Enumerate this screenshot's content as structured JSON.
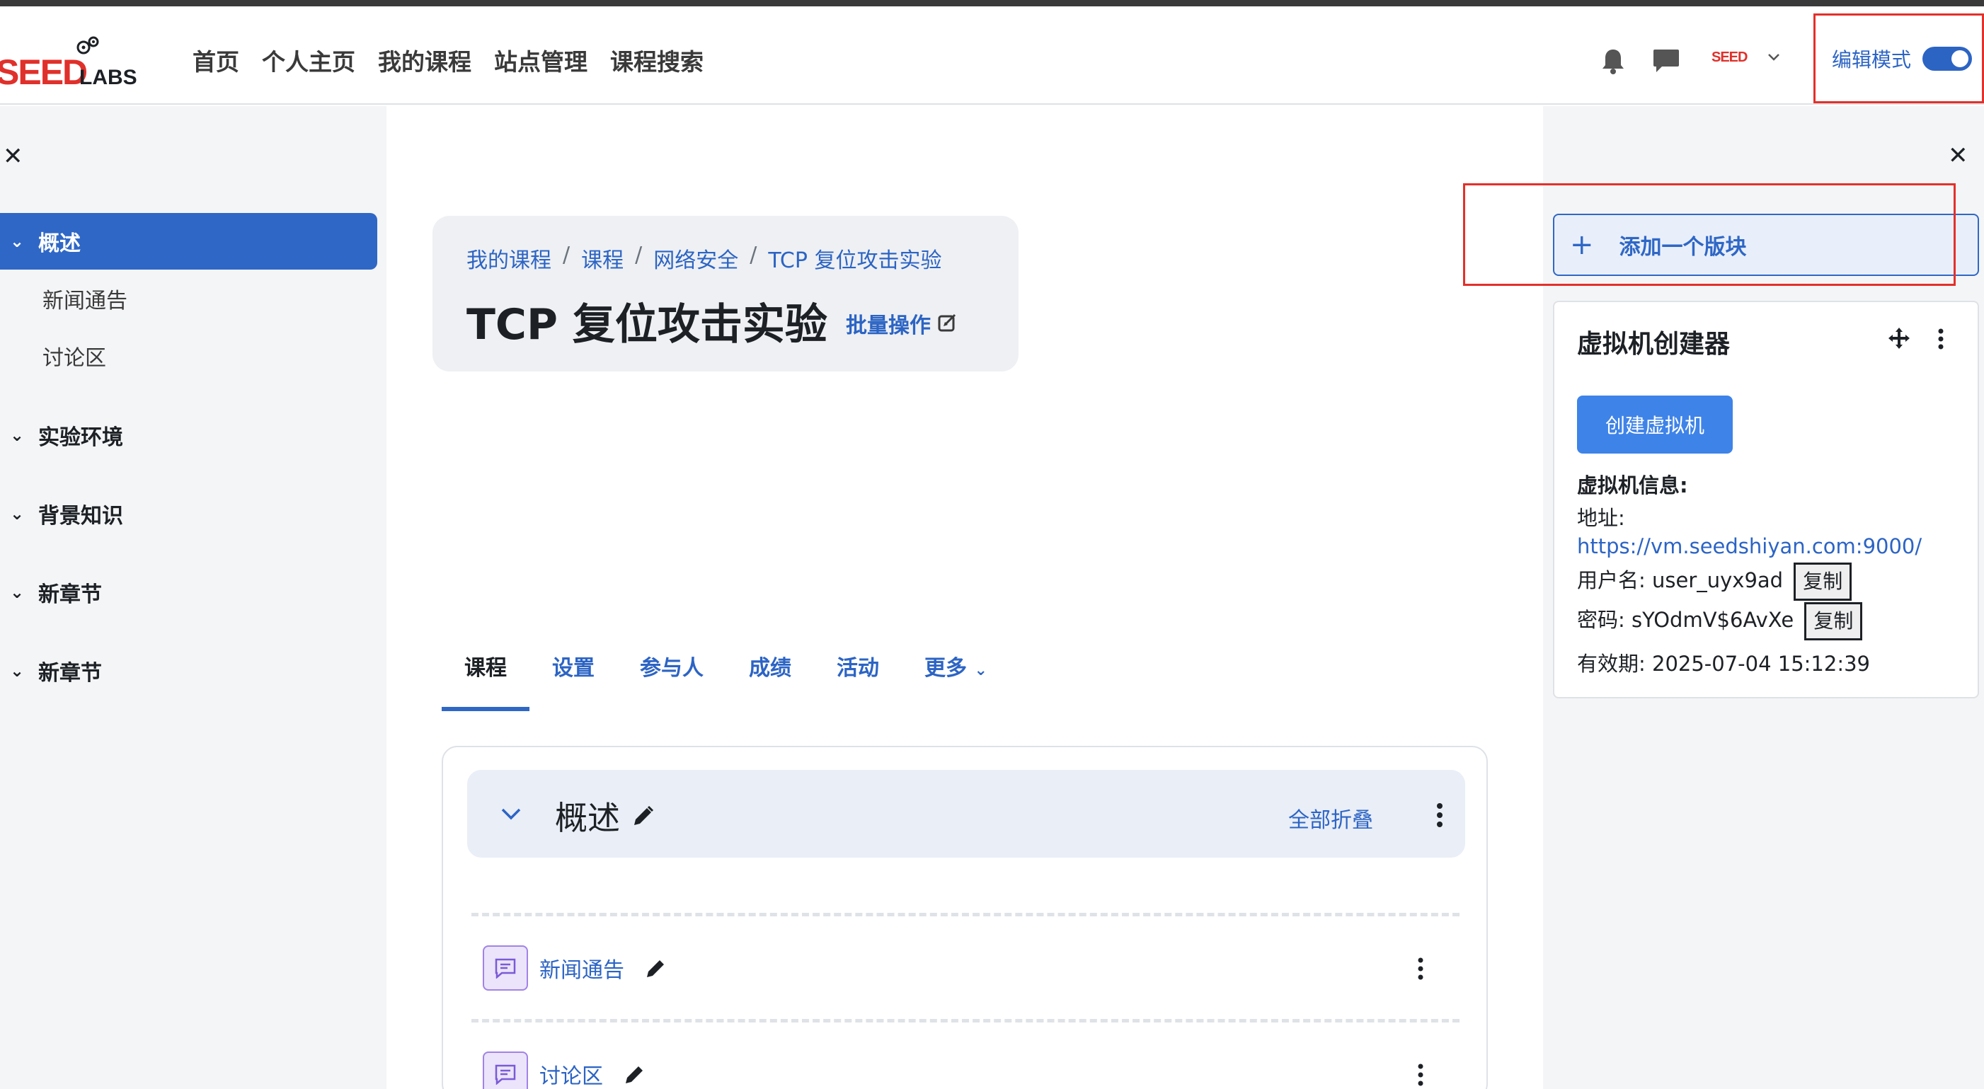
{
  "navbar": {
    "logo_main": "SEED",
    "logo_sub": "LABS",
    "links": [
      "首页",
      "个人主页",
      "我的课程",
      "站点管理",
      "课程搜索"
    ],
    "avatar_text": "SEED",
    "edit_mode_label": "编辑模式",
    "edit_mode_on": true
  },
  "left_drawer": {
    "active_section": "概述",
    "sub_items": [
      "新闻通告",
      "讨论区"
    ],
    "sections": [
      "实验环境",
      "背景知识",
      "新章节",
      "新章节"
    ]
  },
  "header": {
    "breadcrumb": [
      "我的课程",
      "课程",
      "网络安全",
      "TCP 复位攻击实验"
    ],
    "breadcrumb_sep": "/",
    "title": "TCP 复位攻击实验",
    "bulk_edit": "批量操作"
  },
  "tabs": [
    "课程",
    "设置",
    "参与人",
    "成绩",
    "活动",
    "更多"
  ],
  "section": {
    "title": "概述",
    "collapse_all": "全部折叠",
    "activities": [
      "新闻通告",
      "讨论区"
    ]
  },
  "right_drawer": {
    "add_block": "添加一个版块",
    "vm_block": {
      "title": "虚拟机创建器",
      "create_button": "创建虚拟机",
      "info_label": "虚拟机信息:",
      "address_label": "地址:",
      "address": "https://vm.seedshiyan.com:9000/",
      "username_label": "用户名: user_uyx9ad",
      "password_label": "密码: sYOdmV$6AvXe",
      "copy_label": "复制",
      "expiry_label": "有效期: 2025-07-04 15:12:39"
    }
  },
  "colors": {
    "accent": "#2f67c6",
    "link": "#2c64c4",
    "highlight_box": "#e3302b",
    "drawer_bg": "#f4f5f7"
  }
}
